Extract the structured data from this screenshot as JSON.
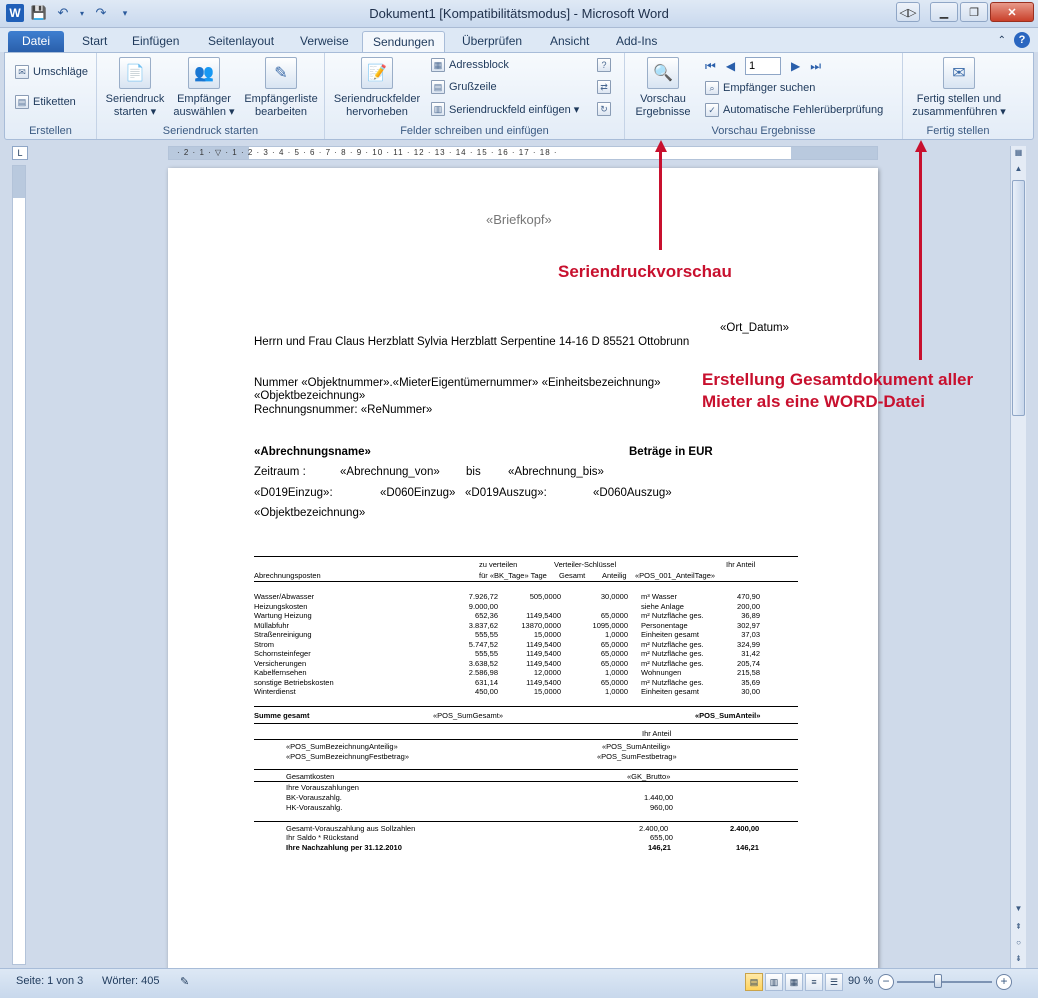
{
  "window": {
    "title": "Dokument1 [Kompatibilitätsmodus] - Microsoft Word",
    "app_icon": "W"
  },
  "tabs": [
    "Datei",
    "Start",
    "Einfügen",
    "Seitenlayout",
    "Verweise",
    "Sendungen",
    "Überprüfen",
    "Ansicht",
    "Add-Ins"
  ],
  "ribbon": {
    "erstellen": {
      "umschlaege": "Umschläge",
      "etiketten": "Etiketten",
      "label": "Erstellen"
    },
    "seriendruck_starten": {
      "btn1": [
        "Seriendruck",
        "starten ▾"
      ],
      "btn2": [
        "Empfänger",
        "auswählen ▾"
      ],
      "btn3": [
        "Empfängerliste",
        "bearbeiten"
      ],
      "label": "Seriendruck starten"
    },
    "felder": {
      "hervorheben": [
        "Seriendruckfelder",
        "hervorheben"
      ],
      "adressblock": "Adressblock",
      "grusszeile": "Grußzeile",
      "einfuegen": "Seriendruckfeld einfügen ▾",
      "label": "Felder schreiben und einfügen"
    },
    "vorschau": {
      "btn": [
        "Vorschau",
        "Ergebnisse"
      ],
      "record": "1",
      "empfaenger_suchen": "Empfänger suchen",
      "fehlerpruefung": "Automatische Fehlerüberprüfung",
      "label": "Vorschau Ergebnisse"
    },
    "fertig": {
      "btn": [
        "Fertig stellen und",
        "zusammenführen ▾"
      ],
      "label": "Fertig stellen"
    }
  },
  "ruler_ticks": "· 2 · 1 · ▽ · 1 · 2 · 3 · 4 · 5 · 6 · 7 · 8 · 9 · 10 · 11 · 12 · 13 · 14 · 15 · 16 · 17 · 18 ·",
  "document": {
    "briefkopf": "«Briefkopf»",
    "ort_datum": "«Ort_Datum»",
    "address": "Herrn und Frau Claus Herzblatt Sylvia Herzblatt Serpentine 14-16 D 85521 Ottobrunn",
    "nummer_line": "Nummer «Objektnummer».«MieterEigentümernummer»  «Einheitsbezeichnung»",
    "objektbezeichnung1": "«Objektbezeichnung»",
    "rechnungsnummer": "Rechnungsnummer: «ReNummer»",
    "abrechnungsname": "«Abrechnungsname»",
    "betraege": "Beträge in EUR",
    "zeitraum": "Zeitraum :",
    "abrechnung_von": "«Abrechnung_von»",
    "bis": "bis",
    "abrechnung_bis": "«Abrechnung_bis»",
    "d019einzug": "«D019Einzug»:",
    "d060einzug": "«D060Einzug»",
    "d019auszug": "«D019Auszug»:",
    "d060auszug": "«D060Auszug»",
    "objektbezeichnung2": "«Objektbezeichnung»",
    "table": {
      "h_zuverteilen": "zu verteilen",
      "h_verteiler": "Verteiler-Schlüssel",
      "h_ihranteil": "Ihr Anteil",
      "h_posten": "Abrechnungsposten",
      "h_fuer": "für «BK_Tage» Tage",
      "h_gesamt": "Gesamt",
      "h_anteilig": "Anteilig",
      "h_pos001": "«POS_001_AnteilTage»",
      "rows": [
        [
          "Wasser/Abwasser",
          "7.926,72",
          "505,0000",
          "30,0000",
          "m³ Wasser",
          "470,90"
        ],
        [
          "Heizungskosten",
          "9.000,00",
          "",
          "",
          "siehe Anlage",
          "200,00"
        ],
        [
          "Wartung Heizung",
          "652,36",
          "1149,5400",
          "65,0000",
          "m² Nutzfläche ges.",
          "36,89"
        ],
        [
          "Müllabfuhr",
          "3.837,62",
          "13870,0000",
          "1095,0000",
          "Personentage",
          "302,97"
        ],
        [
          "Straßenreinigung",
          "555,55",
          "15,0000",
          "1,0000",
          "Einheiten gesamt",
          "37,03"
        ],
        [
          "Strom",
          "5.747,52",
          "1149,5400",
          "65,0000",
          "m² Nutzfläche ges.",
          "324,99"
        ],
        [
          "Schornsteinfeger",
          "555,55",
          "1149,5400",
          "65,0000",
          "m² Nutzfläche ges.",
          "31,42"
        ],
        [
          "Versicherungen",
          "3.638,52",
          "1149,5400",
          "65,0000",
          "m² Nutzfläche ges.",
          "205,74"
        ],
        [
          "Kabelfernsehen",
          "2.586,98",
          "12,0000",
          "1,0000",
          "Wohnungen",
          "215,58"
        ],
        [
          "sonstige Betriebskosten",
          "631,14",
          "1149,5400",
          "65,0000",
          "m² Nutzfläche ges.",
          "35,69"
        ],
        [
          "Winterdienst",
          "450,00",
          "15,0000",
          "1,0000",
          "Einheiten gesamt",
          "30,00"
        ]
      ],
      "summe_gesamt": "Summe gesamt",
      "pos_sumgesamt": "«POS_SumGesamt»",
      "pos_sumanteil": "«POS_SumAnteil»",
      "ihr_anteil2": "Ihr Anteil",
      "sumbez_anteilig": "«POS_SumBezeichnungAnteilig»",
      "sum_anteilig": "«POS_SumAnteilig»",
      "sumbez_fest": "«POS_SumBezeichnungFestbetrag»",
      "sum_fest": "«POS_SumFestbetrag»",
      "gesamtkosten": "Gesamtkosten",
      "gk_brutto": "«GK_Brutto»",
      "vorauszahlungen": "Ihre Vorauszahlungen",
      "bk_voraus": "BK-Vorauszahlg.",
      "bk_voraus_val": "1.440,00",
      "hk_voraus": "HK-Vorauszahlg.",
      "hk_voraus_val": "960,00",
      "gesamt_voraus": "Gesamt-Vorauszahlung aus Sollzahlen",
      "gesamt_voraus_val": "2.400,00",
      "gesamt_voraus_val2": "2.400,00",
      "saldo": "Ihr Saldo * Rückstand",
      "saldo_val": "655,00",
      "nachzahlung": "Ihre Nachzahlung per  31.12.2010",
      "nachzahlung_val": "146,21",
      "nachzahlung_val2": "146,21"
    }
  },
  "annotations": {
    "vorschau": "Seriendruckvorschau",
    "gesamt_line1": "Erstellung Gesamtdokument aller",
    "gesamt_line2": "Mieter als eine WORD-Datei"
  },
  "status": {
    "seite": "Seite: 1 von 3",
    "woerter": "Wörter: 405",
    "zoom": "90 %"
  },
  "colors": {
    "annotation": "#c8102e",
    "file_tab": "#2a5fab"
  }
}
